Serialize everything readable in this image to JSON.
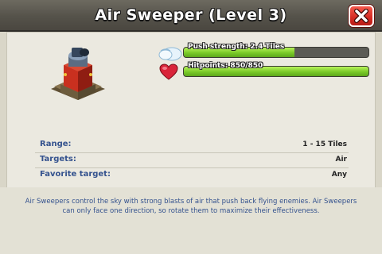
{
  "header": {
    "title": "Air Sweeper (Level 3)",
    "close_icon": "close-icon"
  },
  "colors": {
    "header_bg": "#55524a",
    "panel_bg": "#ebe9e0",
    "bar_fill": "#79c928",
    "label_blue": "#34528e",
    "close_red": "#d52b23"
  },
  "stats": [
    {
      "icon": "wind-cloud-icon",
      "label": "Push strength: 2.4 Tiles",
      "fill": 0.6
    },
    {
      "icon": "heart-icon",
      "label": "Hitpoints: 850/850",
      "fill": 1.0
    }
  ],
  "info": {
    "range_label": "Range:",
    "range_value": "1 - 15 Tiles",
    "targets_label": "Targets:",
    "targets_value": "Air",
    "favorite_label": "Favorite target:",
    "favorite_value": "Any"
  },
  "description": "Air Sweepers control the sky with strong blasts of air that push back flying enemies. Air Sweepers can only face one direction, so rotate them to maximize their effectiveness."
}
